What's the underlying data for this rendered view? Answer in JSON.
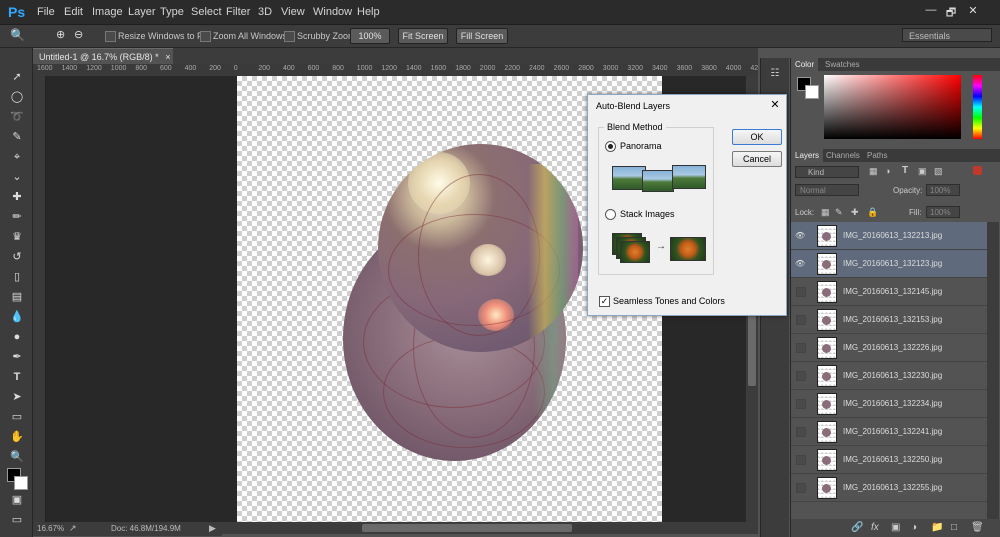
{
  "app": {
    "logo": "Ps"
  },
  "menu": [
    "File",
    "Edit",
    "Image",
    "Layer",
    "Type",
    "Select",
    "Filter",
    "3D",
    "View",
    "Window",
    "Help"
  ],
  "window_controls": {
    "minimize": "—",
    "restore": "🗗",
    "close": "✕"
  },
  "options_bar": {
    "resize_windows": "Resize Windows to Fit",
    "zoom_all": "Zoom All Windows",
    "scrubby": "Scrubby Zoom",
    "btn_100": "100%",
    "btn_fit": "Fit Screen",
    "btn_fill": "Fill Screen",
    "workspace": "Essentials"
  },
  "document": {
    "tab_title": "Untitled-1 @ 16.7% (RGB/8) *",
    "tab_close": "×",
    "zoom": "16.67%",
    "doc_info": "Doc: 46.8M/194.9M"
  },
  "ruler_ticks": [
    "1600",
    "1400",
    "1200",
    "1000",
    "800",
    "600",
    "400",
    "200",
    "0",
    "200",
    "400",
    "600",
    "800",
    "1000",
    "1200",
    "1400",
    "1600",
    "1800",
    "2000",
    "2200",
    "2400",
    "2600",
    "2800",
    "3000",
    "3200",
    "3400",
    "3600",
    "3800",
    "4000",
    "4200"
  ],
  "panels": {
    "color_tabs": [
      "Color",
      "Swatches"
    ],
    "layer_tabs": [
      "Layers",
      "Channels",
      "Paths"
    ],
    "filter_kind": "Kind",
    "blend_mode": "Normal",
    "opacity_label": "Opacity:",
    "opacity_value": "100%",
    "lock_label": "Lock:",
    "fill_label": "Fill:",
    "fill_value": "100%"
  },
  "layers": [
    {
      "name": "IMG_20160613_132213.jpg",
      "selected": true,
      "visible": true
    },
    {
      "name": "IMG_20160613_132123.jpg",
      "selected": true,
      "visible": true
    },
    {
      "name": "IMG_20160613_132145.jpg",
      "selected": false,
      "visible": false
    },
    {
      "name": "IMG_20160613_132153.jpg",
      "selected": false,
      "visible": false
    },
    {
      "name": "IMG_20160613_132226.jpg",
      "selected": false,
      "visible": false
    },
    {
      "name": "IMG_20160613_132230.jpg",
      "selected": false,
      "visible": false
    },
    {
      "name": "IMG_20160613_132234.jpg",
      "selected": false,
      "visible": false
    },
    {
      "name": "IMG_20160613_132241.jpg",
      "selected": false,
      "visible": false
    },
    {
      "name": "IMG_20160613_132250.jpg",
      "selected": false,
      "visible": false
    },
    {
      "name": "IMG_20160613_132255.jpg",
      "selected": false,
      "visible": false
    }
  ],
  "dialog": {
    "title": "Auto-Blend Layers",
    "close": "✕",
    "group_label": "Blend Method",
    "option_panorama": "Panorama",
    "option_stack": "Stack Images",
    "panorama_selected": true,
    "seamless_label": "Seamless Tones and Colors",
    "seamless_checked": true,
    "ok": "OK",
    "cancel": "Cancel"
  }
}
